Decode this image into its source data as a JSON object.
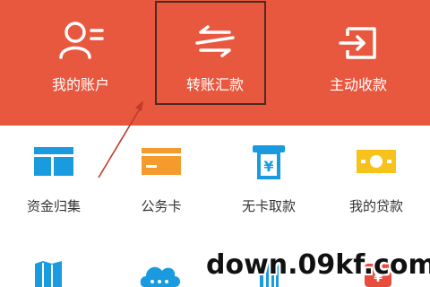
{
  "colors": {
    "banner": "#e8583f",
    "blue": "#1a9be0",
    "orange": "#f59a2d",
    "yellow": "#f7c21b",
    "red": "#e74c3c"
  },
  "top_actions": [
    {
      "label": "我的账户",
      "icon": "user-list-icon"
    },
    {
      "label": "转账汇款",
      "icon": "transfer-arrows-icon"
    },
    {
      "label": "主动收款",
      "icon": "receive-login-icon"
    }
  ],
  "grid": [
    {
      "label": "资金归集",
      "icon": "fund-collection-icon"
    },
    {
      "label": "公务卡",
      "icon": "card-icon"
    },
    {
      "label": "无卡取款",
      "icon": "atm-withdraw-icon"
    },
    {
      "label": "我的贷款",
      "icon": "loan-money-icon"
    }
  ],
  "watermark": "down.09kf.com"
}
